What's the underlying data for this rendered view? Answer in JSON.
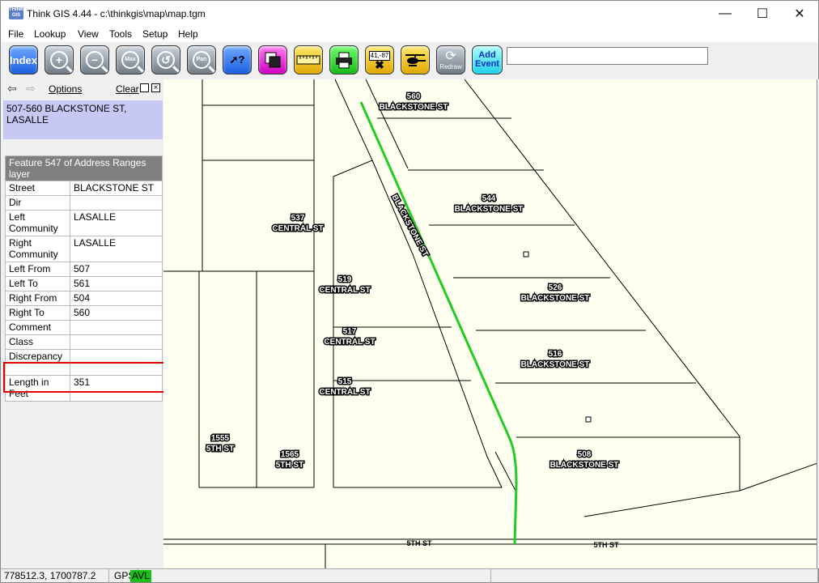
{
  "window": {
    "app_icon_text": "THINK GIS",
    "title": "Think GIS 4.44 - c:\\thinkgis\\map\\map.tgm",
    "min_glyph": "—",
    "max_glyph": "☐",
    "close_glyph": "✕"
  },
  "menu": [
    "File",
    "Lookup",
    "View",
    "Tools",
    "Setup",
    "Help"
  ],
  "toolbar": {
    "index_label": "Index",
    "zoom_in_glyph": "+",
    "zoom_out_glyph": "−",
    "max_label": "Max",
    "pan_label": "Pan",
    "lookup_label": "?",
    "route_label": "41,-87",
    "redraw_label": "Redraw",
    "add_event_label": "Add Event",
    "search_value": "",
    "icons": [
      "index-icon",
      "zoom-in-icon",
      "zoom-out-icon",
      "zoom-max-icon",
      "zoom-previous-icon",
      "pan-icon",
      "identify-icon",
      "layers-icon",
      "measure-ruler-icon",
      "print-icon",
      "coordinate-icon",
      "helicopter-icon",
      "redraw-icon",
      "add-event-icon"
    ]
  },
  "panel": {
    "back_glyph": "⇦",
    "forward_glyph": "⇨",
    "options_label": "Options",
    "clear_label": "Clear",
    "selected_address": "507-560 BLACKSTONE ST, LASALLE",
    "table_caption": "Feature 547 of Address Ranges layer",
    "attributes": [
      {
        "key": "Street",
        "value": "BLACKSTONE ST",
        "tall": false
      },
      {
        "key": "Dir",
        "value": "",
        "tall": false
      },
      {
        "key": "Left Community",
        "value": "LASALLE",
        "tall": true
      },
      {
        "key": "Right Community",
        "value": "LASALLE",
        "tall": true
      },
      {
        "key": "Left From",
        "value": "507",
        "tall": false
      },
      {
        "key": "Left To",
        "value": "561",
        "tall": false
      },
      {
        "key": "Right From",
        "value": "504",
        "tall": false
      },
      {
        "key": "Right To",
        "value": "560",
        "tall": false
      },
      {
        "key": "Comment",
        "value": "",
        "tall": false
      },
      {
        "key": "Class",
        "value": "",
        "tall": false
      },
      {
        "key": "Discrepancy",
        "value": "",
        "tall": true
      },
      {
        "key": "Length in Feet",
        "value": "351",
        "tall": true
      }
    ],
    "highlighted_attribute": "Length in Feet"
  },
  "map": {
    "street_label": "BLACKSTONE ST",
    "bottom_street": "5TH ST",
    "highlight_color": "#22cc22",
    "parcel_labels": [
      {
        "num": "560",
        "street": "BLACKSTONE ST"
      },
      {
        "num": "544",
        "street": "BLACKSTONE ST"
      },
      {
        "num": "537",
        "street": "CENTRAL ST"
      },
      {
        "num": "519",
        "street": "CENTRAL ST"
      },
      {
        "num": "526",
        "street": "BLACKSTONE ST"
      },
      {
        "num": "517",
        "street": "CENTRAL ST"
      },
      {
        "num": "516",
        "street": "BLACKSTONE ST"
      },
      {
        "num": "515",
        "street": "CENTRAL ST"
      },
      {
        "num": "1555",
        "street": "5TH ST"
      },
      {
        "num": "1565",
        "street": "5TH ST"
      },
      {
        "num": "508",
        "street": "BLACKSTONE ST"
      }
    ]
  },
  "status": {
    "coords": "778512.3, 1700787.2",
    "gps_label": "GPS",
    "avl_label": "AVL",
    "avl_color": "#16c016"
  }
}
